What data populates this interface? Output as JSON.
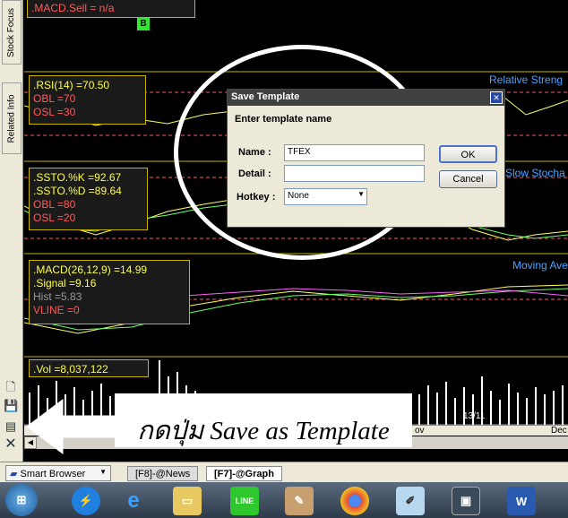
{
  "sidebar": {
    "tabs": [
      "Stock Focus",
      "Related Info"
    ],
    "icons": [
      "new-document-icon",
      "save-icon",
      "save-as-template-icon",
      "close-icon"
    ]
  },
  "chart": {
    "macd_sell": ".MACD.Sell  = n/a",
    "marker": "B",
    "rsi": {
      "line1": ".RSI(14)    =70.50",
      "line2": " OBL    =70",
      "line3": " OSL    =30"
    },
    "ssto": {
      "line1": ".SSTO.%K    =92.67",
      "line2": ".SSTO.%D    =89.64",
      "line3": " OBL    =80",
      "line4": " OSL    =20"
    },
    "macd": {
      "line1": ".MACD(26,12,9)   =14.99",
      "line2": ".Signal   =9.16",
      "line3": " Hist   =5.83",
      "line4": " VLINE   =0"
    },
    "vol": ".Vol    =8,037,122",
    "right_labels": [
      "Relative Streng",
      "Slow Stocha",
      "Moving Ave"
    ],
    "date_labels": [
      "ov",
      "13/11",
      "Dec"
    ]
  },
  "dialog": {
    "title": "Save Template",
    "prompt": "Enter template name",
    "name_label": "Name :",
    "name_value": "TFEX",
    "detail_label": "Detail :",
    "detail_value": "",
    "hotkey_label": "Hotkey :",
    "hotkey_value": "None",
    "ok_label": "OK",
    "cancel_label": "Cancel"
  },
  "annotation": {
    "caption": "กดปุ่ม Save as Template"
  },
  "tabbar": {
    "browser": "Smart Browser",
    "tabs": [
      "[F8]-@News",
      "[F7]-@Graph"
    ]
  },
  "taskbar": {
    "icons": [
      "start-orb-icon",
      "thunderbolt-icon",
      "internet-explorer-icon",
      "file-explorer-icon",
      "line-icon",
      "paint-icon",
      "chrome-icon",
      "notes-icon",
      "app-icon",
      "word-icon"
    ]
  }
}
